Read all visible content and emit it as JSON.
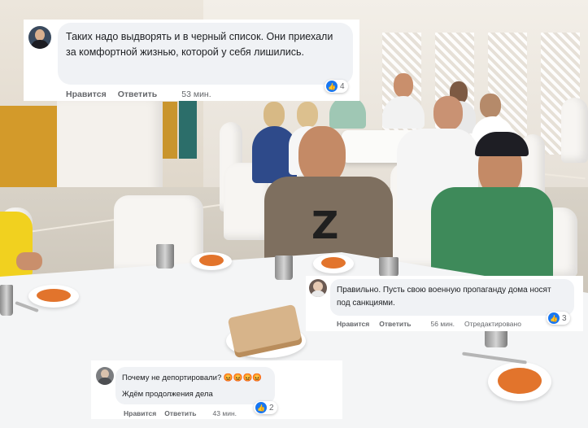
{
  "comments": [
    {
      "text": "Таких надо выдворять и в черный список. Они приехали за комфортной жизнью, которой у себя лишились.",
      "reaction_count": "4",
      "like_label": "Нравится",
      "reply_label": "Ответить",
      "time": "53 мин."
    },
    {
      "text": "Правильно. Пусть свою военную пропаганду дома носят под санкциями.",
      "reaction_count": "3",
      "like_label": "Нравится",
      "reply_label": "Ответить",
      "time": "56 мин.",
      "edited": "Отредактировано"
    },
    {
      "line1": "Почему не депортировали? 😡😡😡😡",
      "line2": "Ждём продолжения дела",
      "reaction_count": "2",
      "like_label": "Нравится",
      "reply_label": "Ответить",
      "time": "43 мин."
    }
  ],
  "photo": {
    "shirt_mark": "Z",
    "colors": {
      "like_blue": "#1877f2",
      "bubble_gray": "#f0f2f5",
      "meta_gray": "#65676b"
    }
  }
}
